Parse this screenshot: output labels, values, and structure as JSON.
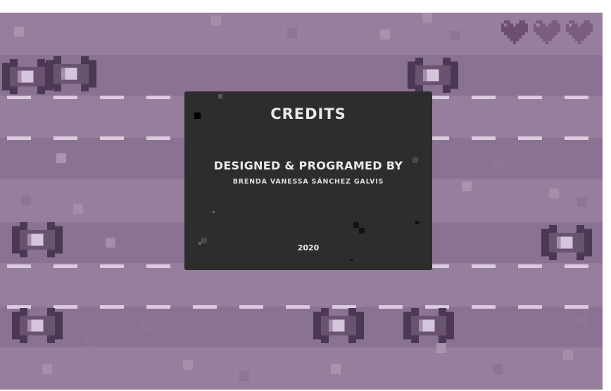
{
  "screen": "credits",
  "lives": {
    "count": 3,
    "max": 3,
    "icon": "heart-icon"
  },
  "credits_panel": {
    "title": "CREDITS",
    "role": "DESIGNED & PROGRAMED BY",
    "author": "BRENDA VANESSA SÁNCHEZ GALVIS",
    "year": "2020"
  },
  "colors": {
    "grass": "#967f9c",
    "road": "#8a7292",
    "lane_marking": "#dccae0",
    "panel": "#2d2d2b",
    "heart": "#7d5a82"
  }
}
